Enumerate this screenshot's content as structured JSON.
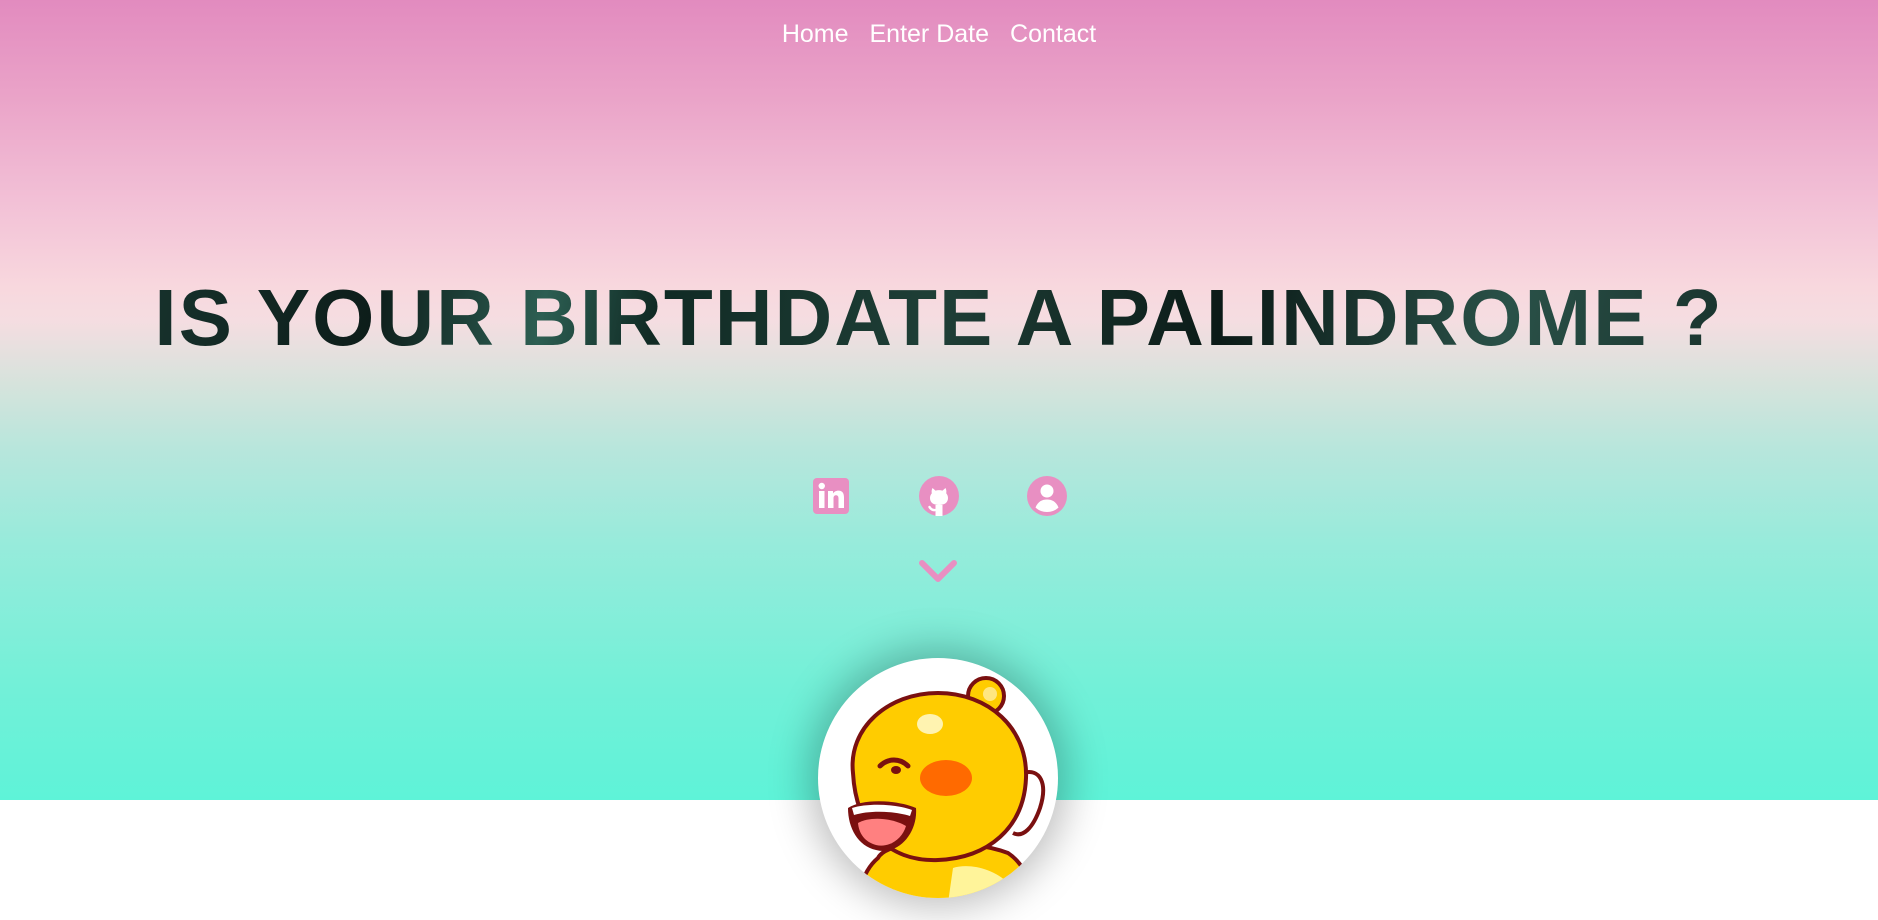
{
  "nav": {
    "items": [
      {
        "label": "Home"
      },
      {
        "label": "Enter Date"
      },
      {
        "label": "Contact"
      }
    ]
  },
  "hero": {
    "headline": "IS YOUR BIRTHDATE A PALINDROME ?"
  },
  "socials": [
    {
      "icon": "linkedin-icon"
    },
    {
      "icon": "github-icon"
    },
    {
      "icon": "user-profile-icon"
    }
  ],
  "scroll": {
    "icon": "chevron-down-icon"
  },
  "avatar": {
    "icon": "cartoon-bear-avatar"
  },
  "colors": {
    "icon_pink": "#e88fc2",
    "headline": "#142b26",
    "gradient_top": "#e28bbf",
    "gradient_bottom": "#5ef3d8"
  }
}
